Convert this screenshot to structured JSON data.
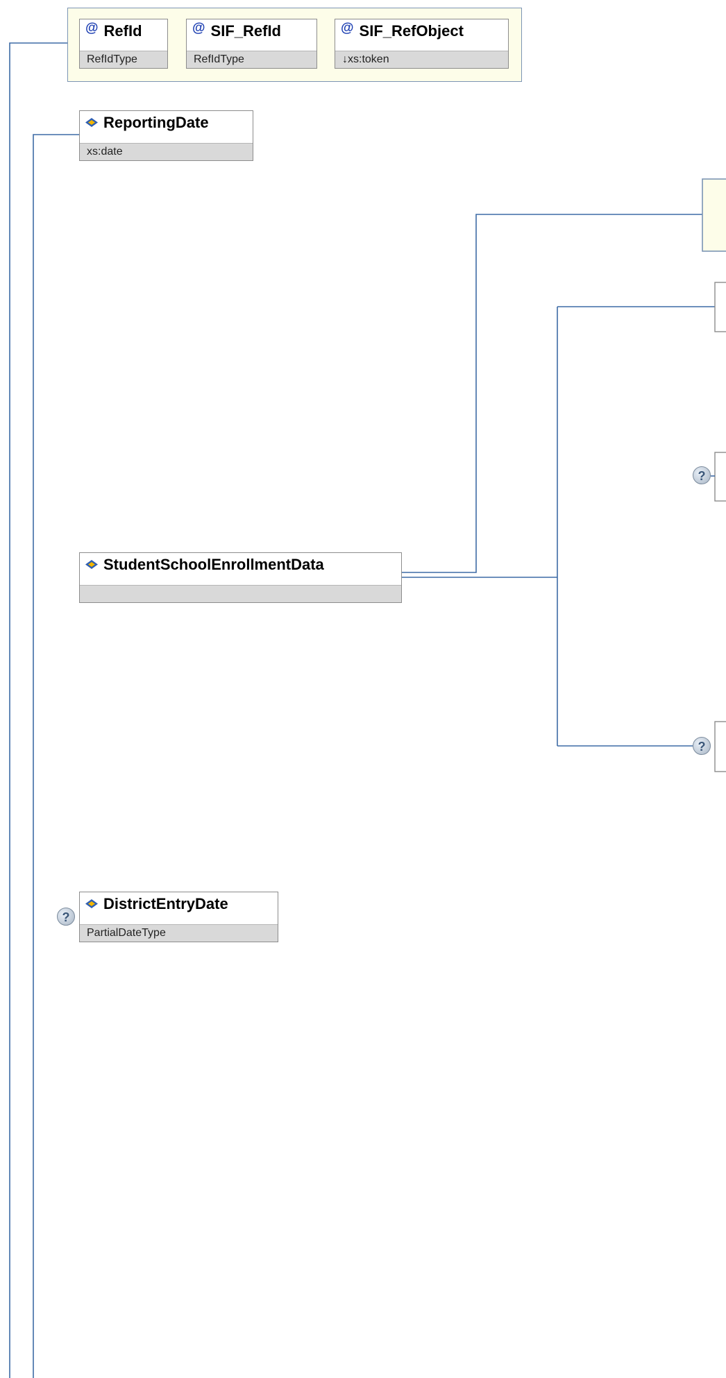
{
  "attributes": [
    {
      "name": "RefId",
      "type": "RefIdType"
    },
    {
      "name": "SIF_RefId",
      "type": "RefIdType"
    },
    {
      "name": "SIF_RefObject",
      "type": "↓xs:token"
    }
  ],
  "elements": {
    "reporting_date": {
      "name": "ReportingDate",
      "type": "xs:date"
    },
    "enrollment": {
      "name": "StudentSchoolEnrollmentData",
      "type": ""
    },
    "district_entry": {
      "name": "DistrictEntryDate",
      "type": "PartialDateType",
      "optional": true
    }
  },
  "optional_marker": "?",
  "colors": {
    "connector": "#3d6aa5",
    "attr_fill": "#fdfde9",
    "type_band": "#d9d9d9",
    "optional_badge": "#a9b6c5"
  },
  "icons": {
    "attribute": "at-icon",
    "element": "element-diamond-icon",
    "optional": "question-mark-icon"
  }
}
